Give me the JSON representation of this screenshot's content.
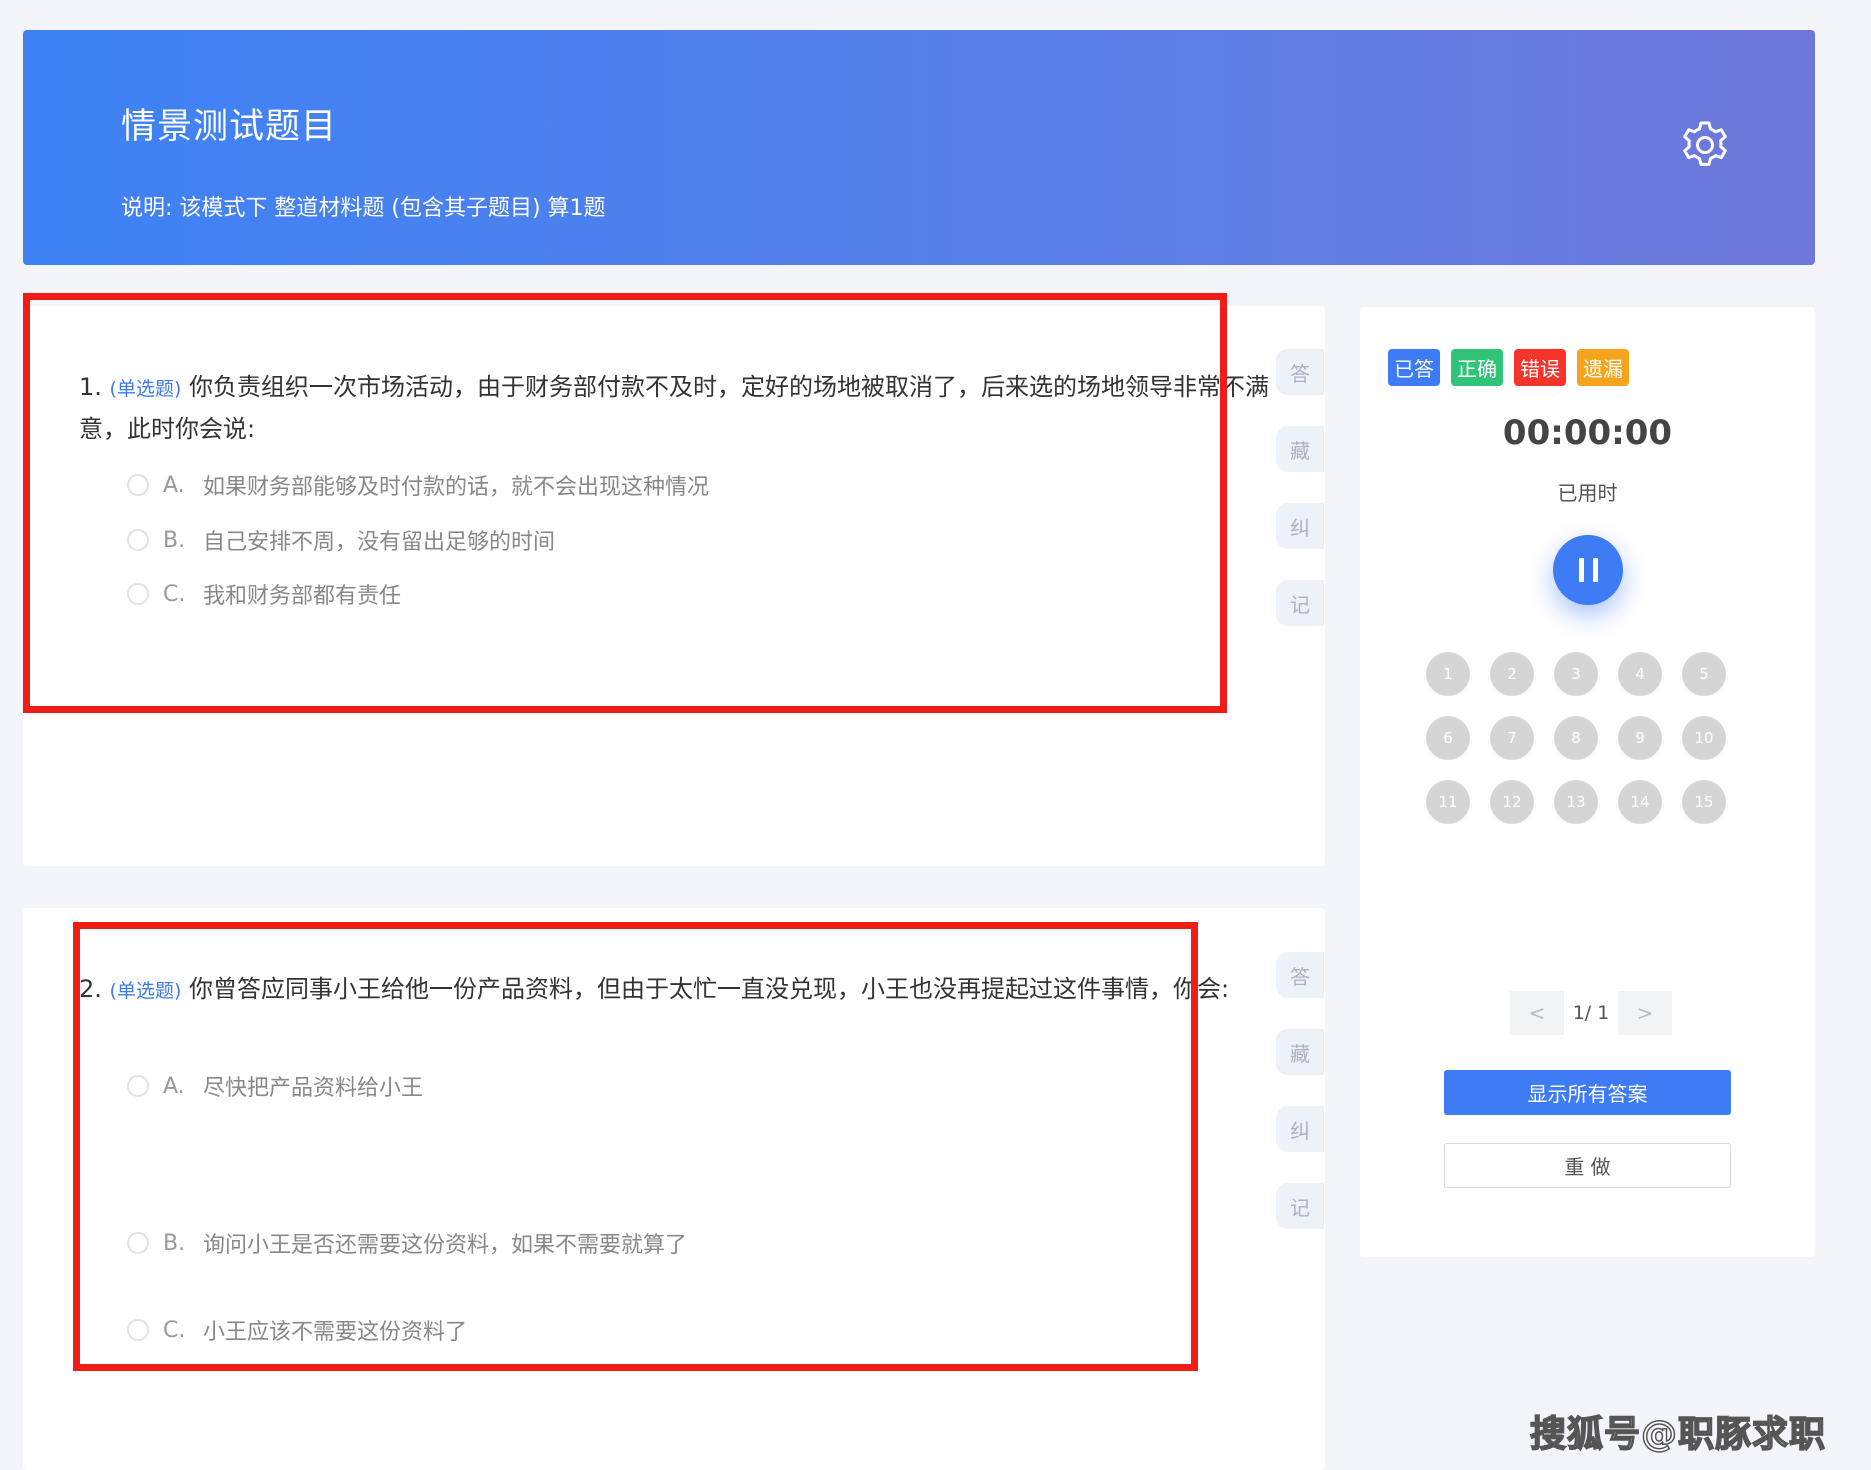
{
  "header": {
    "title": "情景测试题目",
    "description": "说明:  该模式下 整道材料题 (包含其子题目) 算1题",
    "settings_icon": "gear-icon"
  },
  "questions": [
    {
      "number": "1.",
      "type_label": "(单选题)",
      "text": "你负责组织一次市场活动，由于财务部付款不及时，定好的场地被取消了，后来选的场地领导非常不满",
      "text_cont": "意，此时你会说:",
      "options": [
        {
          "letter": "A.",
          "text": "如果财务部能够及时付款的话，就不会出现这种情况"
        },
        {
          "letter": "B.",
          "text": "自己安排不周，没有留出足够的时间"
        },
        {
          "letter": "C.",
          "text": "我和财务部都有责任"
        }
      ]
    },
    {
      "number": "2.",
      "type_label": "(单选题)",
      "text": "你曾答应同事小王给他一份产品资料，但由于太忙一直没兑现，小王也没再提起过这件事情，你会:",
      "options": [
        {
          "letter": "A.",
          "text": "尽快把产品资料给小王"
        },
        {
          "letter": "B.",
          "text": "询问小王是否还需要这份资料，如果不需要就算了"
        },
        {
          "letter": "C.",
          "text": "小王应该不需要这份资料了"
        }
      ]
    }
  ],
  "side_actions": [
    "答",
    "藏",
    "纠",
    "记"
  ],
  "legend": [
    {
      "label": "已答",
      "color": "#3d7cf5"
    },
    {
      "label": "正确",
      "color": "#2fc478"
    },
    {
      "label": "错误",
      "color": "#f5342c"
    },
    {
      "label": "遗漏",
      "color": "#f4a51d"
    }
  ],
  "timer": {
    "value": "00:00:00",
    "label": "已用时"
  },
  "question_numbers": [
    "1",
    "2",
    "3",
    "4",
    "5",
    "6",
    "7",
    "8",
    "9",
    "10",
    "11",
    "12",
    "13",
    "14",
    "15"
  ],
  "pager": {
    "prev": "<",
    "text": "1/ 1",
    "next": ">"
  },
  "buttons": {
    "show_answers": "显示所有答案",
    "redo": "重 做"
  },
  "watermark": "搜狐号@职豚求职"
}
